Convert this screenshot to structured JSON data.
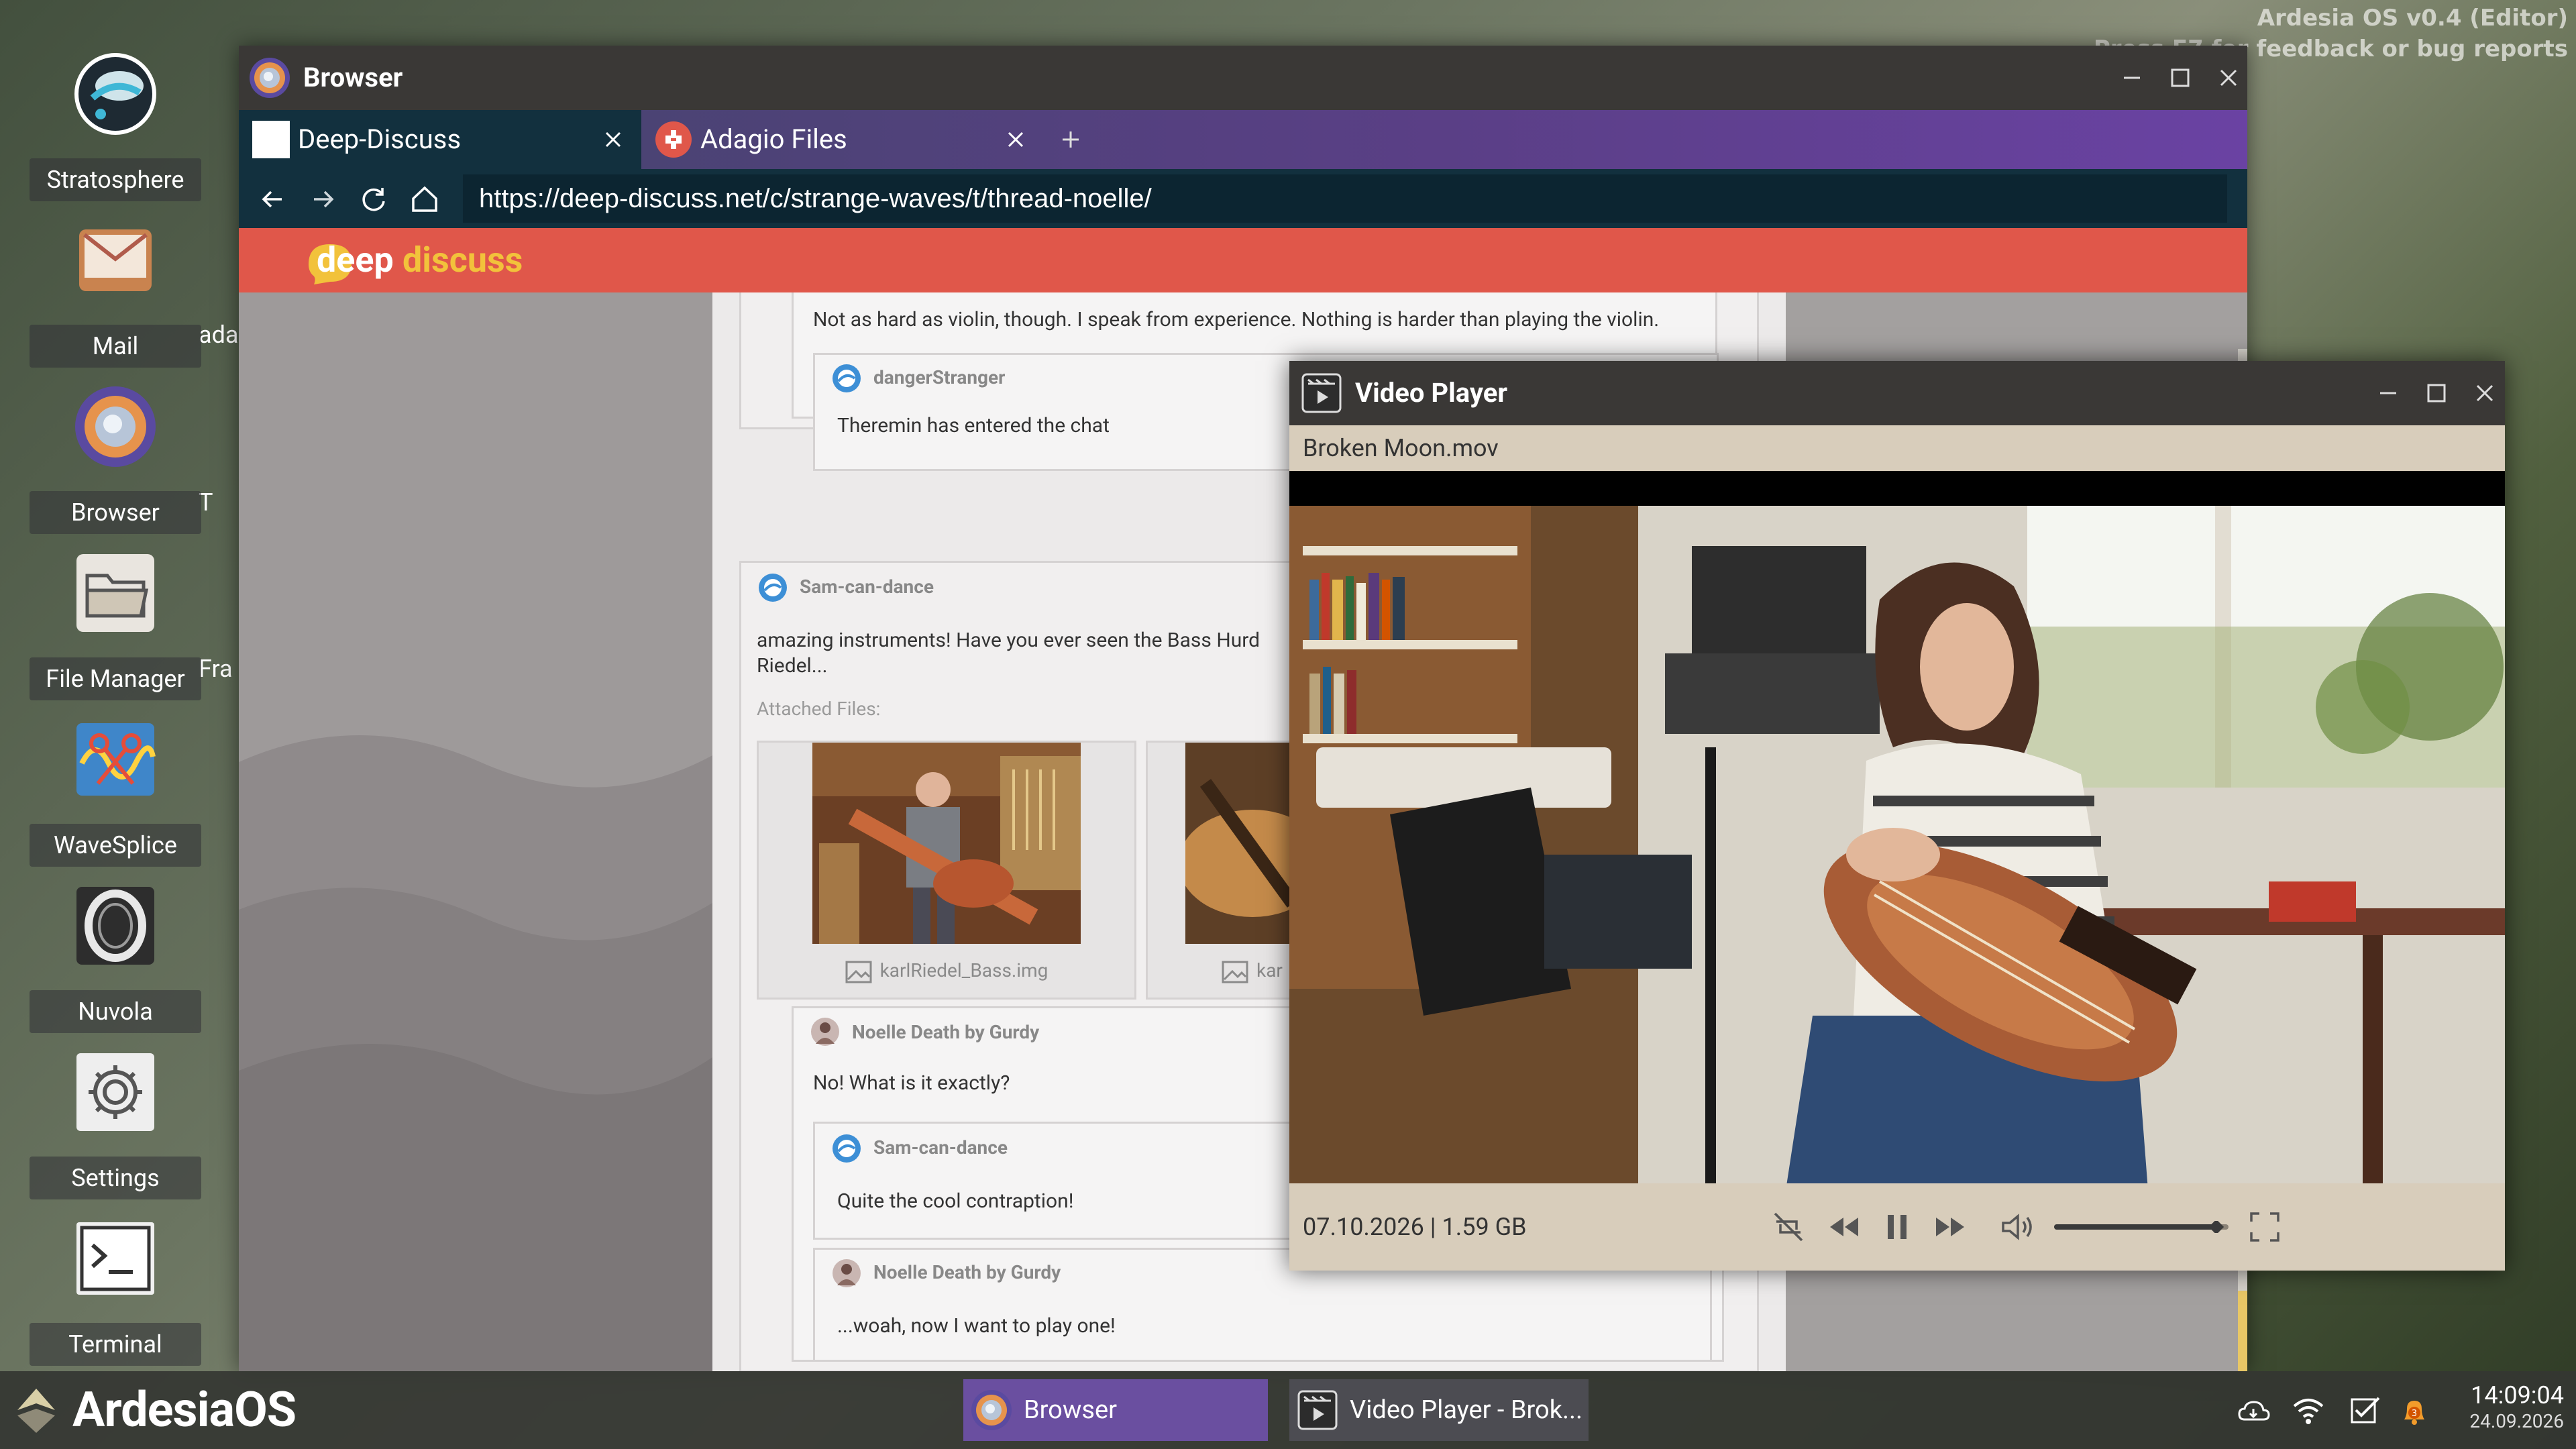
{
  "watermark": {
    "line1": "Ardesia OS v0.4 (Editor)",
    "line2": "Press F7 for feedback or bug reports"
  },
  "desktop": {
    "icons": [
      {
        "label": "Stratosphere",
        "icon": "stratosphere-icon"
      },
      {
        "label": "Mail",
        "icon": "mail-icon"
      },
      {
        "label": "Browser",
        "icon": "browser-icon"
      },
      {
        "label": "File Manager",
        "icon": "folder-icon"
      },
      {
        "label": "WaveSplice",
        "icon": "wavesplice-icon"
      },
      {
        "label": "Nuvola",
        "icon": "nuvola-icon"
      },
      {
        "label": "Settings",
        "icon": "gear-icon"
      },
      {
        "label": "Terminal",
        "icon": "terminal-icon"
      }
    ],
    "peek_labels": [
      "ada",
      "T",
      "Fra"
    ]
  },
  "browser": {
    "title": "Browser",
    "tabs": [
      {
        "label": "Deep-Discuss",
        "active": true
      },
      {
        "label": "Adagio Files",
        "active": false
      }
    ],
    "url": "https://deep-discuss.net/c/strange-waves/t/thread-noelle/",
    "site": {
      "logo_part1": "deep",
      "logo_part2": "discuss"
    },
    "thread": {
      "top_post_text": "Not as hard as violin, though. I speak from experience. Nothing is harder than playing the violin.",
      "reply1": {
        "author": "dangerStranger",
        "text": "Theremin has entered the chat"
      },
      "post2": {
        "author": "Sam-can-dance",
        "text_line1": "amazing instruments! Have you ever seen the Bass Hurd",
        "text_line2": "Riedel...",
        "attached_label": "Attached Files:",
        "attachments": [
          {
            "name": "karlRiedel_Bass.img"
          },
          {
            "name": "kar"
          }
        ]
      },
      "reply2": {
        "author": "Noelle Death by Gurdy",
        "text": "No! What is it exactly?"
      },
      "reply3": {
        "author": "Sam-can-dance",
        "text": "Quite the cool contraption!"
      },
      "reply4": {
        "author": "Noelle Death by Gurdy",
        "text": "...woah, now I want to play one!"
      }
    }
  },
  "video_player": {
    "title": "Video Player",
    "file_name": "Broken Moon.mov",
    "info": "07.10.2026 | 1.59 GB",
    "volume_level": 0.93,
    "state": "playing"
  },
  "taskbar": {
    "os_name": "ArdesiaOS",
    "items": [
      {
        "label": "Browser",
        "active": true
      },
      {
        "label": "Video Player - Brok...",
        "active": false
      }
    ],
    "notification_count": "3",
    "time": "14:09:04",
    "date": "24.09.2026"
  },
  "colors": {
    "site_header": "#e0574a",
    "logo_accent": "#f2c23b",
    "tab_bar_start": "#43456b",
    "tab_bar_end": "#6a42a3",
    "nav_bg": "#12303e",
    "player_chrome": "#d8cdbb",
    "taskbar_active": "#6a4fa0"
  }
}
